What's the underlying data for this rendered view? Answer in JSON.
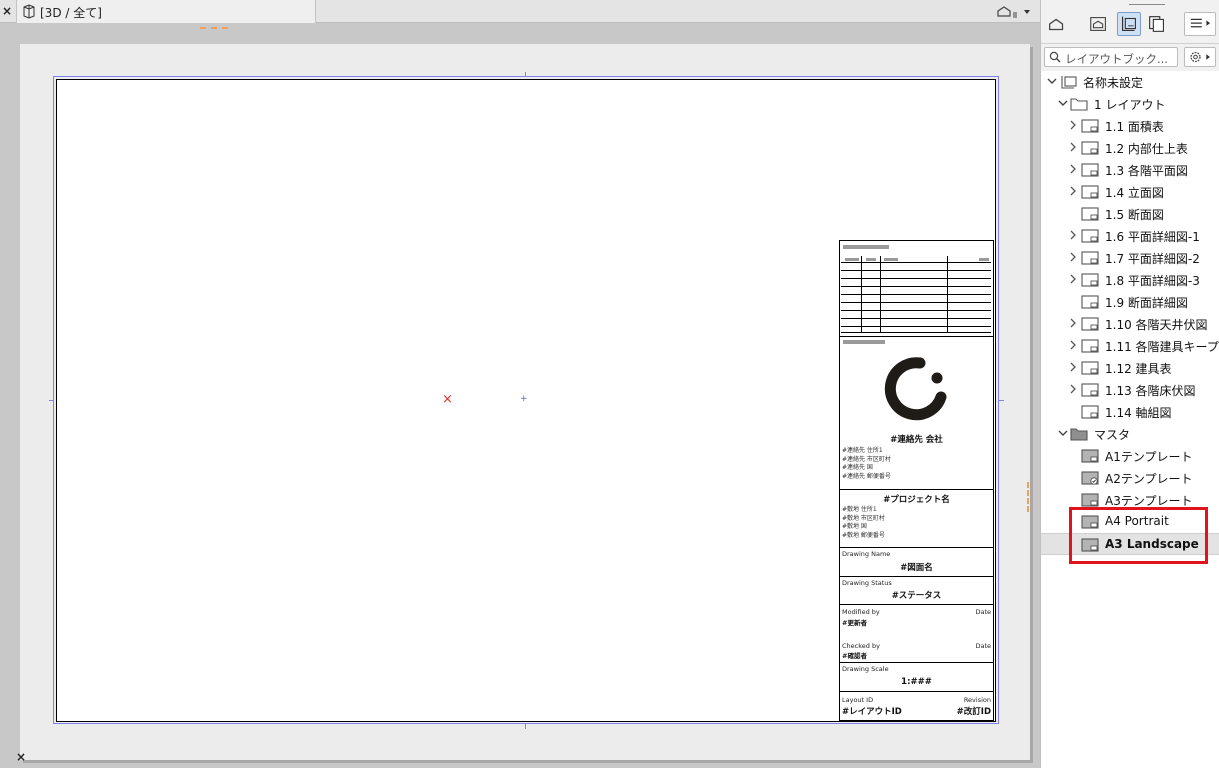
{
  "canvas": {
    "tab_close_glyph": "×",
    "tab_label": "[3D / 全て]",
    "origin_marker": "×",
    "corner_glyph": "×"
  },
  "title_block": {
    "company": "#連絡先 会社",
    "company_address": [
      "#連絡先 住所1",
      "#連絡先 市区町村",
      "#連絡先 国",
      "#連絡先 郵便番号"
    ],
    "project_name": "#プロジェクト名",
    "site_address": [
      "#敷地 住所1",
      "#敷地 市区町村",
      "#敷地 国",
      "#敷地 郵便番号"
    ],
    "drawing_name_label": "Drawing Name",
    "drawing_name": "#図面名",
    "drawing_status_label": "Drawing Status",
    "drawing_status": "#ステータス",
    "modified_by_label": "Modified by",
    "modified_by": "#更新者",
    "date_label": "Date",
    "checked_by_label": "Checked by",
    "checked_by": "#確認者",
    "drawing_scale_label": "Drawing Scale",
    "drawing_scale": "1:###",
    "layout_id_label": "Layout ID",
    "layout_id": "#レイアウトID",
    "revision_label": "Revision",
    "revision": "#改訂ID"
  },
  "navigator": {
    "search_placeholder": "レイアウトブック...",
    "book": "名称未設定",
    "subset_layout": "1 レイアウト",
    "layouts": [
      "1.1 面積表",
      "1.2 内部仕上表",
      "1.3 各階平面図",
      "1.4 立面図",
      "1.5 断面図",
      "1.6 平面詳細図-1",
      "1.7 平面詳細図-2",
      "1.8 平面詳細図-3",
      "1.9 断面詳細図",
      "1.10 各階天井伏図",
      "1.11 各階建具キープラ",
      "1.12 建具表",
      "1.13 各階床伏図",
      "1.14 軸組図"
    ],
    "subset_master": "マスタ",
    "masters": [
      "A1テンプレート",
      "A2テンプレート",
      "A3テンプレート",
      "A4 Portrait",
      "A3 Landscape"
    ]
  },
  "colors": {
    "highlight": "#e0141c",
    "print_bounds": "#8080ee",
    "origin": "#e0302a",
    "logo": "#1f1b16"
  }
}
